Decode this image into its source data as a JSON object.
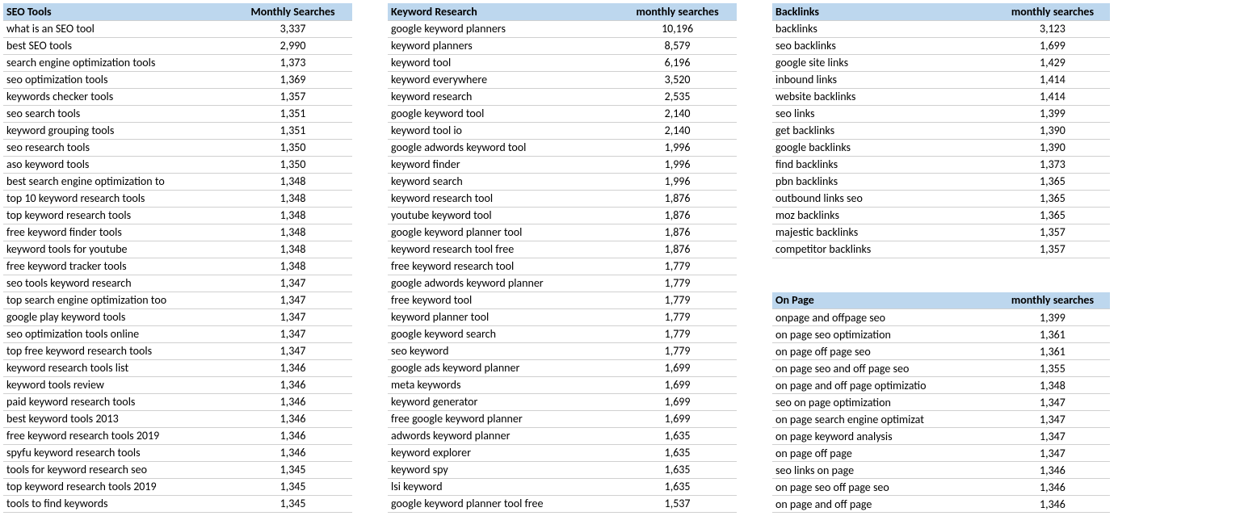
{
  "tables": {
    "seo_tools": {
      "headers": [
        "SEO Tools",
        "Monthly Searches"
      ],
      "rows": [
        [
          "what is an SEO tool",
          "3,337"
        ],
        [
          "best SEO tools",
          "2,990"
        ],
        [
          "search engine optimization tools",
          "1,373"
        ],
        [
          "seo optimization tools",
          "1,369"
        ],
        [
          "keywords checker tools",
          "1,357"
        ],
        [
          "seo search tools",
          "1,351"
        ],
        [
          "keyword grouping tools",
          "1,351"
        ],
        [
          "seo research tools",
          "1,350"
        ],
        [
          "aso keyword tools",
          "1,350"
        ],
        [
          "best search engine optimization to",
          "1,348"
        ],
        [
          "top 10 keyword research tools",
          "1,348"
        ],
        [
          "top keyword research tools",
          "1,348"
        ],
        [
          "free keyword finder tools",
          "1,348"
        ],
        [
          "keyword tools for youtube",
          "1,348"
        ],
        [
          "free keyword tracker tools",
          "1,348"
        ],
        [
          "seo tools keyword research",
          "1,347"
        ],
        [
          "top search engine optimization too",
          "1,347"
        ],
        [
          "google play keyword tools",
          "1,347"
        ],
        [
          "seo optimization tools online",
          "1,347"
        ],
        [
          "top free keyword research tools",
          "1,347"
        ],
        [
          "keyword research tools list",
          "1,346"
        ],
        [
          "keyword tools review",
          "1,346"
        ],
        [
          "paid keyword research tools",
          "1,346"
        ],
        [
          "best keyword tools 2013",
          "1,346"
        ],
        [
          "free keyword research tools 2019",
          "1,346"
        ],
        [
          "spyfu keyword research tools",
          "1,346"
        ],
        [
          "tools for keyword research seo",
          "1,345"
        ],
        [
          "top keyword research tools 2019",
          "1,345"
        ],
        [
          "tools to find keywords",
          "1,345"
        ]
      ]
    },
    "keyword_research": {
      "headers": [
        "Keyword Research",
        "monthly searches"
      ],
      "rows": [
        [
          "google keyword planners",
          "10,196"
        ],
        [
          "keyword planners",
          "8,579"
        ],
        [
          "keyword tool",
          "6,196"
        ],
        [
          "keyword everywhere",
          "3,520"
        ],
        [
          "keyword research",
          "2,535"
        ],
        [
          "google keyword tool",
          "2,140"
        ],
        [
          "keyword tool io",
          "2,140"
        ],
        [
          "google adwords keyword tool",
          "1,996"
        ],
        [
          "keyword finder",
          "1,996"
        ],
        [
          "keyword search",
          "1,996"
        ],
        [
          "keyword research tool",
          "1,876"
        ],
        [
          "youtube keyword tool",
          "1,876"
        ],
        [
          "google keyword planner tool",
          "1,876"
        ],
        [
          "keyword research tool free",
          "1,876"
        ],
        [
          "free keyword research tool",
          "1,779"
        ],
        [
          "google adwords keyword planner",
          "1,779"
        ],
        [
          "free keyword tool",
          "1,779"
        ],
        [
          "keyword planner tool",
          "1,779"
        ],
        [
          "google keyword search",
          "1,779"
        ],
        [
          "seo keyword",
          "1,779"
        ],
        [
          "google ads keyword planner",
          "1,699"
        ],
        [
          "meta keywords",
          "1,699"
        ],
        [
          "keyword generator",
          "1,699"
        ],
        [
          "free google keyword planner",
          "1,699"
        ],
        [
          "adwords keyword planner",
          "1,635"
        ],
        [
          "keyword explorer",
          "1,635"
        ],
        [
          "keyword spy",
          "1,635"
        ],
        [
          "lsi keyword",
          "1,635"
        ],
        [
          "google keyword planner tool free",
          "1,537"
        ]
      ]
    },
    "backlinks": {
      "headers": [
        "Backlinks",
        "monthly searches"
      ],
      "rows": [
        [
          "backlinks",
          "3,123"
        ],
        [
          "seo backlinks",
          "1,699"
        ],
        [
          "google site links",
          "1,429"
        ],
        [
          "inbound links",
          "1,414"
        ],
        [
          "website backlinks",
          "1,414"
        ],
        [
          "seo links",
          "1,399"
        ],
        [
          "get backlinks",
          "1,390"
        ],
        [
          "google backlinks",
          "1,390"
        ],
        [
          "find backlinks",
          "1,373"
        ],
        [
          "pbn backlinks",
          "1,365"
        ],
        [
          "outbound links seo",
          "1,365"
        ],
        [
          "moz backlinks",
          "1,365"
        ],
        [
          "majestic backlinks",
          "1,357"
        ],
        [
          "competitor backlinks",
          "1,357"
        ]
      ]
    },
    "on_page": {
      "headers": [
        "On Page",
        "monthly searches"
      ],
      "rows": [
        [
          "onpage and offpage seo",
          "1,399"
        ],
        [
          "on page seo optimization",
          "1,361"
        ],
        [
          "on page off page seo",
          "1,361"
        ],
        [
          "on page seo and off page seo",
          "1,355"
        ],
        [
          "on page and off page optimizatio",
          "1,348"
        ],
        [
          "seo on page optimization",
          "1,347"
        ],
        [
          "on page search engine optimizat",
          "1,347"
        ],
        [
          "on page keyword analysis",
          "1,347"
        ],
        [
          "on page off page",
          "1,347"
        ],
        [
          "seo links on page",
          "1,346"
        ],
        [
          "on page seo off page seo",
          "1,346"
        ],
        [
          "on page and off page",
          "1,346"
        ]
      ]
    }
  }
}
